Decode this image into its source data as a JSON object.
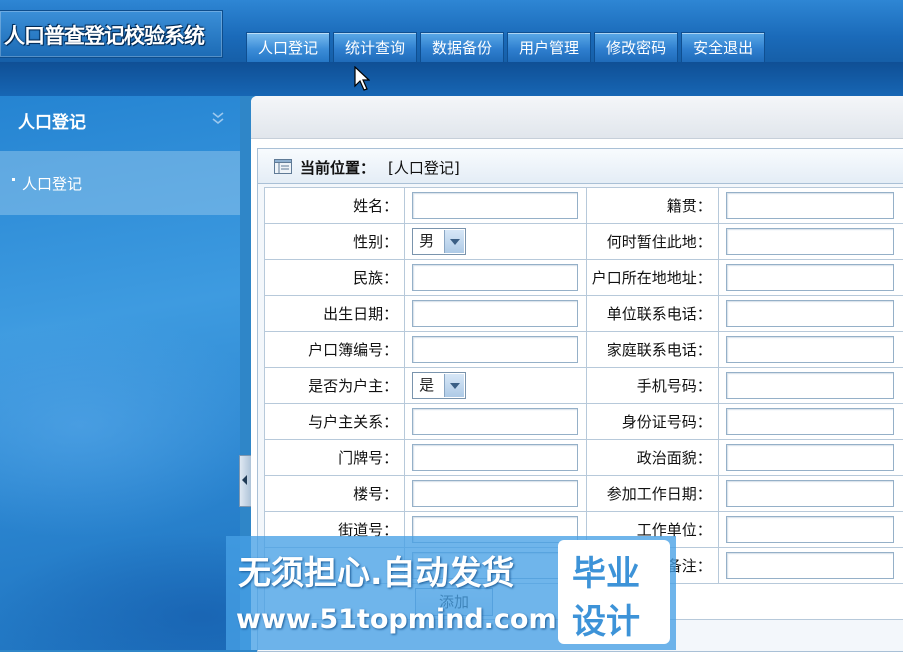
{
  "app": {
    "logo_text": "人口普查登记校验系统"
  },
  "nav": {
    "tabs": [
      "人口登记",
      "统计查询",
      "数据备份",
      "用户管理",
      "修改密码",
      "安全退出"
    ]
  },
  "sidebar": {
    "title": "人口登记",
    "items": [
      "人口登记"
    ]
  },
  "panel": {
    "location_label": "当前位置：",
    "location_value": "[人口登记]"
  },
  "form": {
    "left": [
      {
        "label": "姓名：",
        "type": "text",
        "value": ""
      },
      {
        "label": "性别：",
        "type": "select",
        "value": "男"
      },
      {
        "label": "民族：",
        "type": "text",
        "value": ""
      },
      {
        "label": "出生日期：",
        "type": "text",
        "value": ""
      },
      {
        "label": "户口簿编号：",
        "type": "text",
        "value": ""
      },
      {
        "label": "是否为户主：",
        "type": "select",
        "value": "是"
      },
      {
        "label": "与户主关系：",
        "type": "text",
        "value": ""
      },
      {
        "label": "门牌号：",
        "type": "text",
        "value": ""
      },
      {
        "label": "楼号：",
        "type": "text",
        "value": ""
      },
      {
        "label": "街道号：",
        "type": "text",
        "value": ""
      },
      {
        "label": "",
        "type": "text",
        "value": ""
      }
    ],
    "right": [
      {
        "label": "籍贯：",
        "value": ""
      },
      {
        "label": "何时暂住此地：",
        "value": ""
      },
      {
        "label": "户口所在地地址：",
        "value": ""
      },
      {
        "label": "单位联系电话：",
        "value": ""
      },
      {
        "label": "家庭联系电话：",
        "value": ""
      },
      {
        "label": "手机号码：",
        "value": ""
      },
      {
        "label": "身份证号码：",
        "value": ""
      },
      {
        "label": "政治面貌：",
        "value": ""
      },
      {
        "label": "参加工作日期：",
        "value": ""
      },
      {
        "label": "工作单位：",
        "value": ""
      },
      {
        "label": "备注：",
        "value": ""
      }
    ],
    "submit_label": "添加"
  },
  "watermark": {
    "line1": "无须担心.自动发货",
    "line2": "www.51topmind.com",
    "badge_top": "毕业",
    "badge_bottom": "设计"
  }
}
